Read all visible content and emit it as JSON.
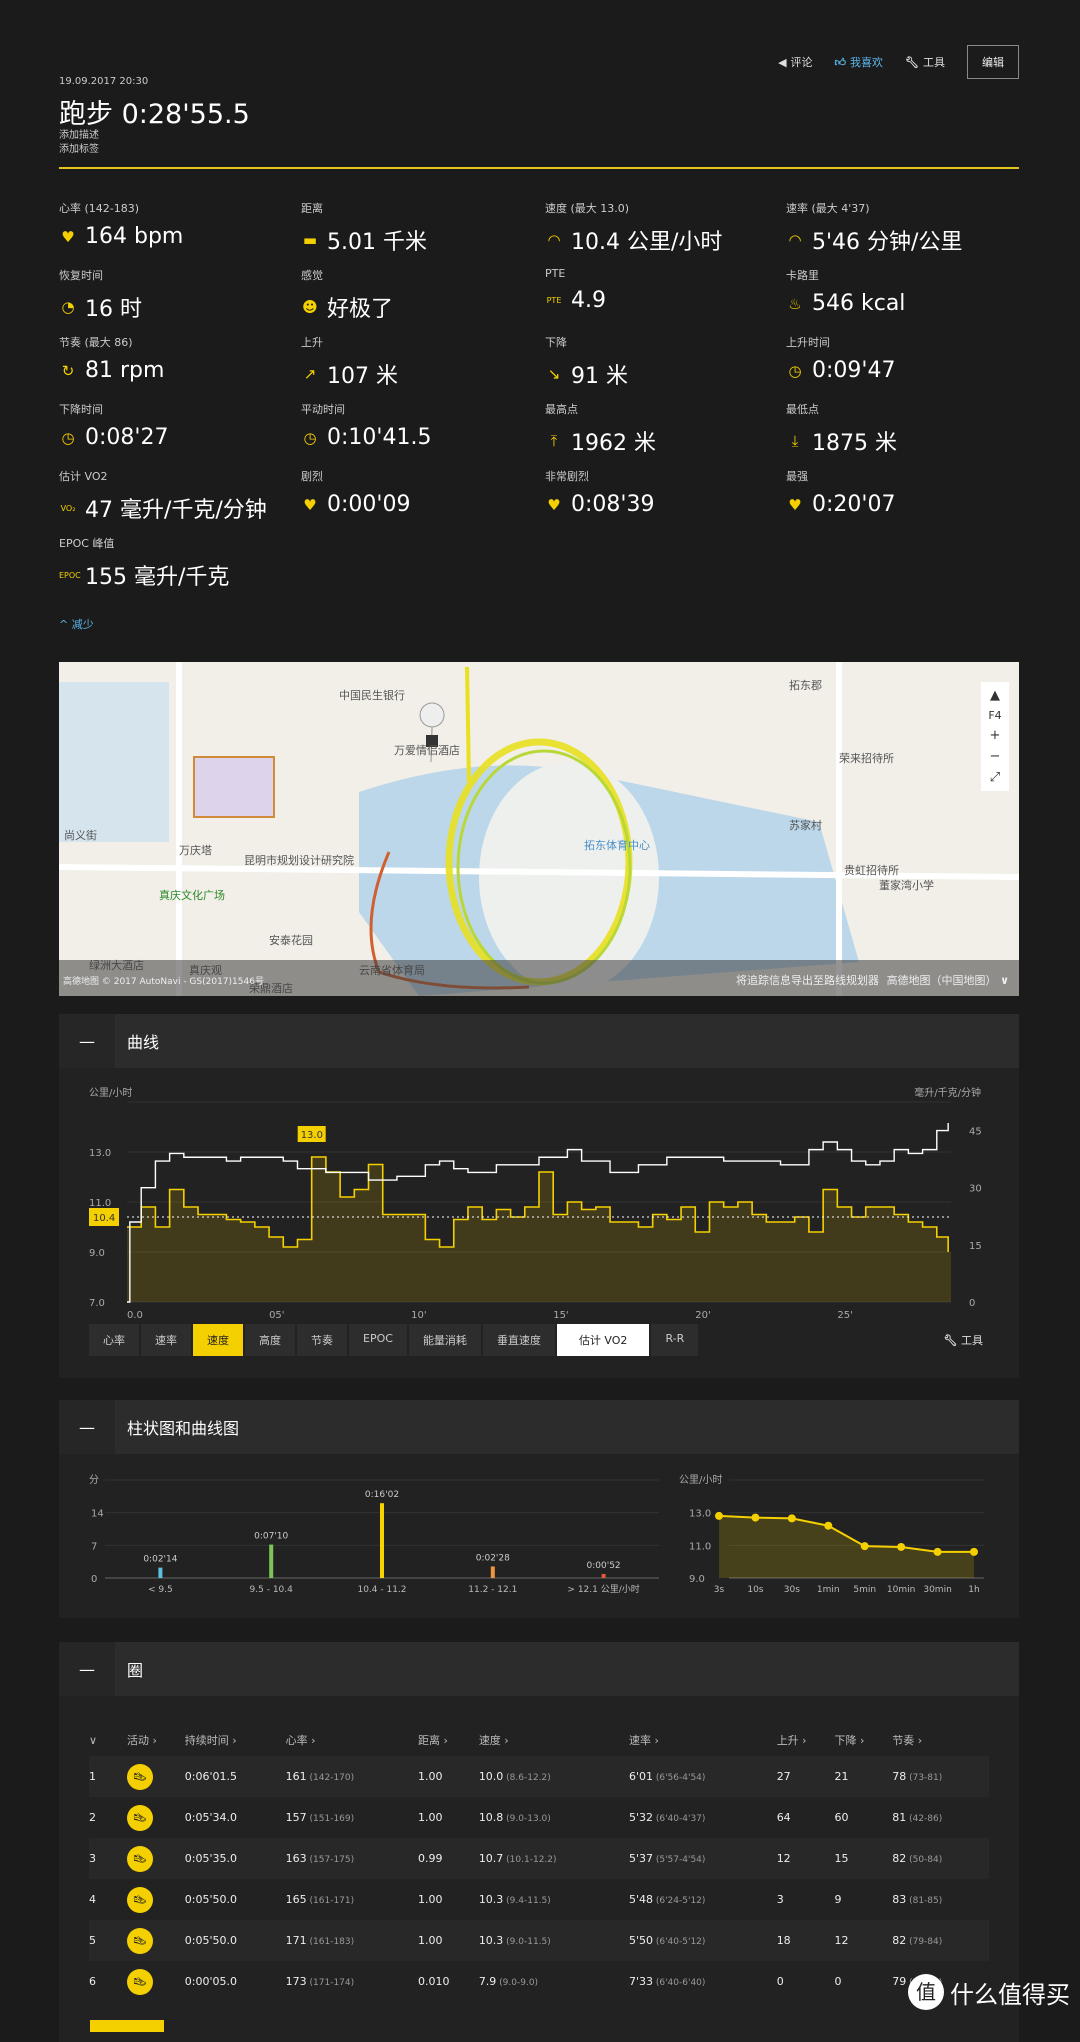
{
  "header": {
    "actions": [
      {
        "icon": "megaphone-icon",
        "label": "评论"
      },
      {
        "icon": "thumbs-up-icon",
        "label": "我喜欢"
      },
      {
        "icon": "wrench-icon",
        "label": "工具"
      }
    ],
    "edit_label": "编辑",
    "date": "19.09.2017 20:30",
    "title": "跑步 0:28'55.5",
    "add_description": "添加描述",
    "add_tags": "添加标签"
  },
  "colors": {
    "accent": "#f5d000",
    "link": "#5ab4e8",
    "background": "#1b1b1b"
  },
  "stats": [
    {
      "label": "心率 (142-183)",
      "value": "164 bpm",
      "icon": "heart-icon",
      "glyph": "♥"
    },
    {
      "label": "距离",
      "value": "5.01 千米",
      "icon": "ruler-icon",
      "glyph": "▬"
    },
    {
      "label": "速度 (最大 13.0)",
      "value": "10.4 公里/小时",
      "icon": "speedometer-icon",
      "glyph": "◠"
    },
    {
      "label": "速率 (最大 4'37)",
      "value": "5'46 分钟/公里",
      "icon": "speedometer-icon",
      "glyph": "◠"
    },
    {
      "label": "恢复时间",
      "value": "16 时",
      "icon": "recovery-icon",
      "glyph": "◔"
    },
    {
      "label": "感觉",
      "value": "好极了",
      "icon": "smiley-icon",
      "glyph": "☻"
    },
    {
      "label": "PTE",
      "value": "4.9",
      "icon": "pte-icon",
      "glyph": "PTE"
    },
    {
      "label": "卡路里",
      "value": "546 kcal",
      "icon": "flame-icon",
      "glyph": "♨"
    },
    {
      "label": "节奏 (最大 86)",
      "value": "81 rpm",
      "icon": "cadence-icon",
      "glyph": "↻"
    },
    {
      "label": "上升",
      "value": "107 米",
      "icon": "arrow-up-right-icon",
      "glyph": "↗"
    },
    {
      "label": "下降",
      "value": "91 米",
      "icon": "arrow-down-right-icon",
      "glyph": "↘"
    },
    {
      "label": "上升时间",
      "value": "0:09'47",
      "icon": "stopwatch-icon",
      "glyph": "◷"
    },
    {
      "label": "下降时间",
      "value": "0:08'27",
      "icon": "stopwatch-icon",
      "glyph": "◷"
    },
    {
      "label": "平动时间",
      "value": "0:10'41.5",
      "icon": "stopwatch-icon",
      "glyph": "◷"
    },
    {
      "label": "最高点",
      "value": "1962 米",
      "icon": "highest-point-icon",
      "glyph": "⤒"
    },
    {
      "label": "最低点",
      "value": "1875 米",
      "icon": "lowest-point-icon",
      "glyph": "⤓"
    },
    {
      "label": "估计 VO2",
      "value": "47 毫升/千克/分钟",
      "icon": "vo2-icon",
      "glyph": "VO₂"
    },
    {
      "label": "剧烈",
      "value": "0:00'09",
      "icon": "heart-zone-icon",
      "glyph": "♥"
    },
    {
      "label": "非常剧烈",
      "value": "0:08'39",
      "icon": "heart-zone-icon",
      "glyph": "♥"
    },
    {
      "label": "最强",
      "value": "0:20'07",
      "icon": "heart-zone-icon",
      "glyph": "♥"
    },
    {
      "label": "EPOC 峰值",
      "value": "155 毫升/千克",
      "icon": "epoc-icon",
      "glyph": "EPOC"
    }
  ],
  "less_label": "^ 减少",
  "map": {
    "labels": [
      "中国民生银行",
      "拓东郡",
      "万爱情侣酒店",
      "荣来招待所",
      "尚义街",
      "万庆塔",
      "昆明市规划设计研究院",
      "拓东体育中心",
      "苏家村",
      "贵虹招待所",
      "真庆文化广场",
      "董家湾小学",
      "安泰花园",
      "真庆观",
      "绿洲大酒店",
      "云南省体育局",
      "荣鼎酒店"
    ],
    "footer_left": "高德地图 © 2017 AutoNavi - GS(2017)1546号",
    "export_label": "将追踪信息导出至路线规划器",
    "provider_label": "高德地图（中国地图）"
  },
  "curve": {
    "title": "曲线",
    "tabs": [
      "心率",
      "速率",
      "速度",
      "高度",
      "节奏",
      "EPOC",
      "能量消耗",
      "垂直速度",
      "估计 VO2",
      "R-R"
    ],
    "selected": "速度",
    "secondary": "估计 VO2",
    "tools_label": "工具"
  },
  "bars_section": {
    "title": "柱状图和曲线图"
  },
  "laps": {
    "title": "圈",
    "columns": [
      "活动",
      "持续时间",
      "心率",
      "距离",
      "速度",
      "速率",
      "上升",
      "下降",
      "节奏"
    ],
    "rows": [
      {
        "n": "1",
        "dur": "0:06'01.5",
        "hr": "161",
        "hr_r": "(142-170)",
        "dist": "1.00",
        "spd": "10.0",
        "spd_r": "(8.6-12.2)",
        "pace": "6'01",
        "pace_r": "(6'56-4'54)",
        "up": "27",
        "down": "21",
        "cad": "78",
        "cad_r": "(73-81)"
      },
      {
        "n": "2",
        "dur": "0:05'34.0",
        "hr": "157",
        "hr_r": "(151-169)",
        "dist": "1.00",
        "spd": "10.8",
        "spd_r": "(9.0-13.0)",
        "pace": "5'32",
        "pace_r": "(6'40-4'37)",
        "up": "64",
        "down": "60",
        "cad": "81",
        "cad_r": "(42-86)"
      },
      {
        "n": "3",
        "dur": "0:05'35.0",
        "hr": "163",
        "hr_r": "(157-175)",
        "dist": "0.99",
        "spd": "10.7",
        "spd_r": "(10.1-12.2)",
        "pace": "5'37",
        "pace_r": "(5'57-4'54)",
        "up": "12",
        "down": "15",
        "cad": "82",
        "cad_r": "(50-84)"
      },
      {
        "n": "4",
        "dur": "0:05'50.0",
        "hr": "165",
        "hr_r": "(161-171)",
        "dist": "1.00",
        "spd": "10.3",
        "spd_r": "(9.4-11.5)",
        "pace": "5'48",
        "pace_r": "(6'24-5'12)",
        "up": "3",
        "down": "9",
        "cad": "83",
        "cad_r": "(81-85)"
      },
      {
        "n": "5",
        "dur": "0:05'50.0",
        "hr": "171",
        "hr_r": "(161-183)",
        "dist": "1.00",
        "spd": "10.3",
        "spd_r": "(9.0-11.5)",
        "pace": "5'50",
        "pace_r": "(6'40-5'12)",
        "up": "18",
        "down": "12",
        "cad": "82",
        "cad_r": "(79-84)"
      },
      {
        "n": "6",
        "dur": "0:00'05.0",
        "hr": "173",
        "hr_r": "(171-174)",
        "dist": "0.010",
        "spd": "7.9",
        "spd_r": "(9.0-9.0)",
        "pace": "7'33",
        "pace_r": "(6'40-6'40)",
        "up": "0",
        "down": "0",
        "cad": "79",
        "cad_r": "(79-80)"
      }
    ]
  },
  "watermark": {
    "text": "什么值得买",
    "glyph": "值"
  },
  "chart_data": [
    {
      "type": "line",
      "ylabel": "公里/小时",
      "y2label": "毫升/千克/分钟",
      "ylim": [
        7,
        15
      ],
      "y2lim": [
        0,
        52.5
      ],
      "yticks": [
        "7.0",
        "9.0",
        "11.0",
        "13.0"
      ],
      "y2ticks": [
        "0",
        "15",
        "30",
        "45"
      ],
      "xticks": [
        "0.0",
        "05'",
        "10'",
        "15'",
        "20'",
        "25'"
      ],
      "xlim": [
        0,
        29
      ],
      "avg": 10.4,
      "avg_label": "10.4",
      "max_label": "13.0",
      "max_at": 6.5,
      "max": 13.0,
      "grid": true,
      "series": [
        {
          "key": "speed",
          "color": "#f5d000",
          "x": [
            0,
            0.5,
            1,
            1.5,
            2,
            2.5,
            3,
            3.5,
            4,
            4.5,
            5,
            5.5,
            6,
            6.5,
            7,
            7.5,
            8,
            8.5,
            9,
            9.5,
            10,
            10.5,
            11,
            11.5,
            12,
            12.5,
            13,
            13.5,
            14,
            14.5,
            15,
            15.5,
            16,
            16.5,
            17,
            17.5,
            18,
            18.5,
            19,
            19.5,
            20,
            20.5,
            21,
            21.5,
            22,
            22.5,
            23,
            23.5,
            24,
            24.5,
            25,
            25.5,
            26,
            26.5,
            27,
            27.5,
            28,
            28.5,
            28.9
          ],
          "values": [
            10.0,
            10.8,
            10.0,
            11.5,
            10.8,
            10.5,
            10.5,
            10.3,
            10.2,
            10.0,
            9.6,
            9.2,
            9.5,
            12.8,
            12.2,
            11.2,
            11.5,
            12.5,
            10.5,
            10.5,
            10.5,
            9.5,
            9.2,
            10.3,
            10.8,
            10.3,
            10.7,
            10.4,
            10.8,
            12.2,
            10.5,
            11.0,
            10.7,
            10.8,
            10.2,
            10.2,
            10.0,
            10.5,
            10.3,
            10.8,
            9.8,
            11.0,
            10.8,
            11.0,
            10.5,
            10.2,
            10.2,
            10.4,
            9.8,
            11.5,
            10.8,
            10.4,
            10.8,
            10.8,
            10.5,
            10.2,
            10.0,
            9.6,
            9.0
          ]
        },
        {
          "key": "vo2",
          "color": "#ffffff",
          "x": [
            0,
            0.1,
            0.5,
            1,
            1.5,
            2,
            3,
            3.5,
            4,
            5,
            5.5,
            6,
            7,
            8,
            8.5,
            9.5,
            10.5,
            11,
            11.5,
            12,
            13,
            14,
            14.5,
            15,
            15.5,
            16,
            17,
            18,
            19,
            20,
            21,
            22,
            23,
            24,
            24.5,
            25,
            25.5,
            26,
            26.5,
            27,
            27.5,
            28,
            28.5,
            28.9
          ],
          "values": [
            0,
            21,
            30,
            37,
            39,
            38,
            38,
            37,
            38,
            38,
            37,
            35,
            34,
            34,
            32,
            33,
            36,
            37,
            35,
            34,
            36,
            36,
            38,
            38,
            40,
            37,
            34,
            36,
            38,
            38,
            37,
            37,
            36,
            40,
            42,
            40,
            37,
            36,
            37,
            40,
            39,
            40,
            45,
            47
          ]
        }
      ]
    },
    {
      "type": "bar",
      "ylabel": "分",
      "ylim": [
        0,
        21
      ],
      "yticks": [
        "0",
        "7",
        "14"
      ],
      "categories": [
        "< 9.5",
        "9.5 - 10.4",
        "10.4 - 11.2",
        "11.2 - 12.1",
        "> 12.1 公里/小时"
      ],
      "values": [
        2.23,
        7.17,
        16.03,
        2.47,
        0.87
      ],
      "labels": [
        "0:02'14",
        "0:07'10",
        "0:16'02",
        "0:02'28",
        "0:00'52"
      ],
      "colors": [
        "#5bc0de",
        "#7cc35a",
        "#f5d400",
        "#f0953a",
        "#e05a3a"
      ],
      "grid": true
    },
    {
      "type": "line",
      "ylabel": "公里/小时",
      "ylim": [
        9,
        15
      ],
      "yticks": [
        "9.0",
        "11.0",
        "13.0"
      ],
      "categories": [
        "3s",
        "10s",
        "30s",
        "1min",
        "5min",
        "10min",
        "30min",
        "1h"
      ],
      "values": [
        12.8,
        12.7,
        12.65,
        12.2,
        10.95,
        10.9,
        10.6,
        10.6
      ],
      "color": "#f5d000",
      "grid": true
    }
  ]
}
